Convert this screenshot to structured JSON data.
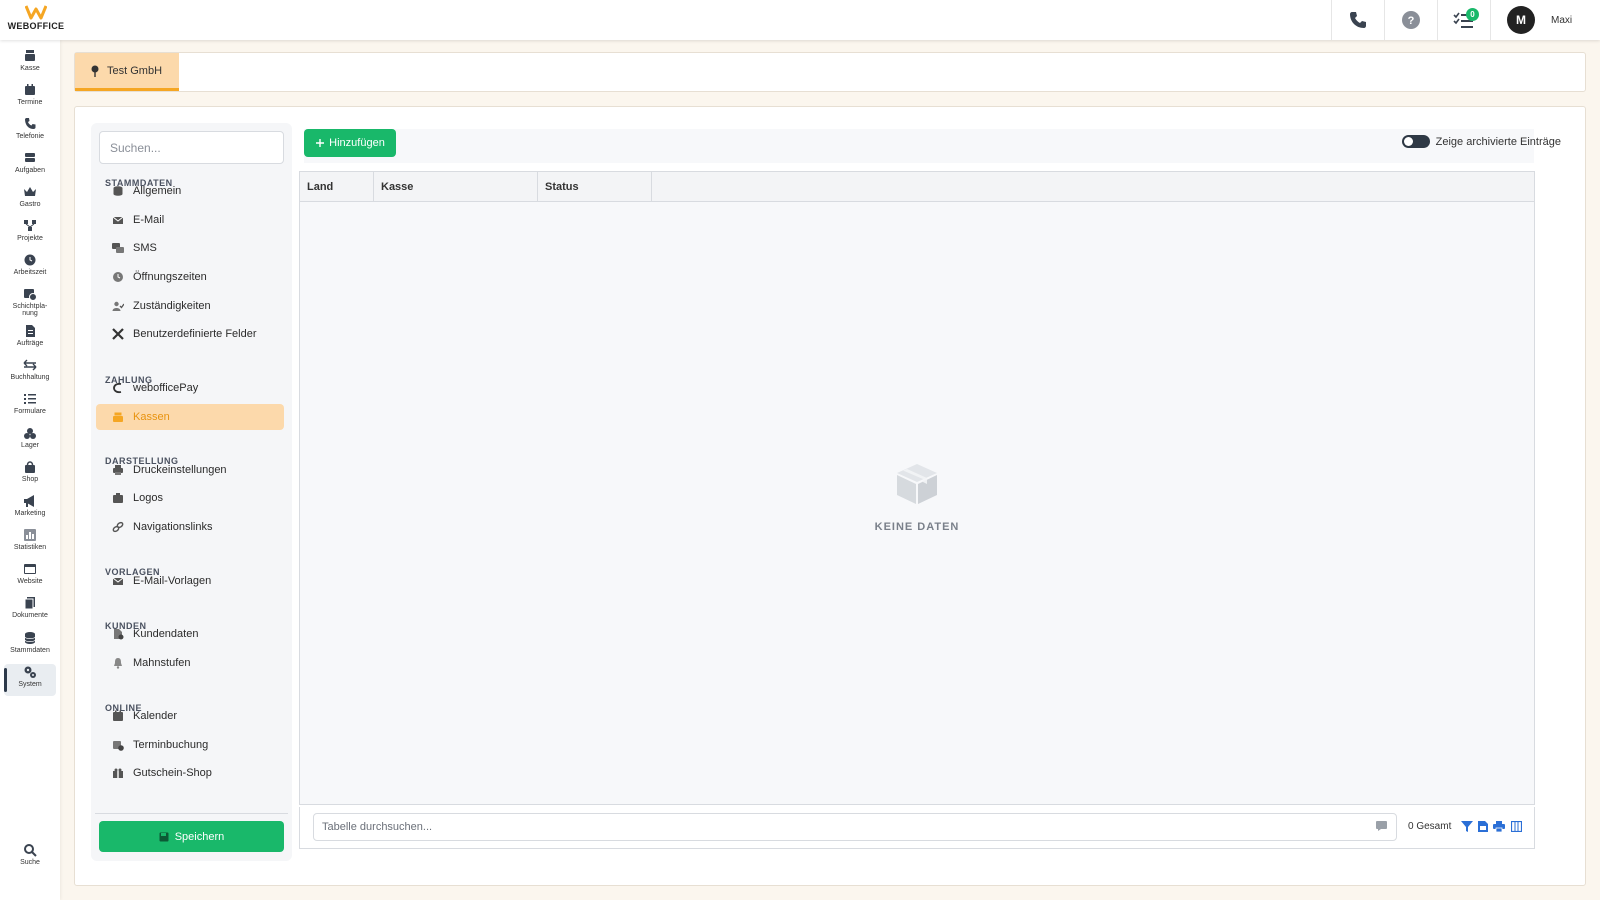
{
  "brand": {
    "name": "WEBOFFICE",
    "accent": "#f5a623",
    "green": "#19b86a"
  },
  "top": {
    "icons": [
      "phone-icon",
      "help-icon",
      "tasks-icon"
    ],
    "task_badge": "0",
    "user_initial": "M",
    "user_name": "Maxi"
  },
  "nav": [
    {
      "label": "Kasse",
      "icon": "register-icon"
    },
    {
      "label": "Termine",
      "icon": "calendar-icon"
    },
    {
      "label": "Telefonie",
      "icon": "phone-icon"
    },
    {
      "label": "Aufgaben",
      "icon": "tasks-icon"
    },
    {
      "label": "Gastro",
      "icon": "crown-icon"
    },
    {
      "label": "Projekte",
      "icon": "project-icon"
    },
    {
      "label": "Arbeitszeit",
      "icon": "clock-icon"
    },
    {
      "label": "Schichtpla-\nnung",
      "icon": "shift-icon"
    },
    {
      "label": "Aufträge",
      "icon": "order-icon"
    },
    {
      "label": "Buchhaltung",
      "icon": "exchange-icon"
    },
    {
      "label": "Formulare",
      "icon": "form-icon"
    },
    {
      "label": "Lager",
      "icon": "boxes-icon"
    },
    {
      "label": "Shop",
      "icon": "bag-icon"
    },
    {
      "label": "Marketing",
      "icon": "megaphone-icon"
    },
    {
      "label": "Statistiken",
      "icon": "chart-icon"
    },
    {
      "label": "Website",
      "icon": "browser-icon"
    },
    {
      "label": "Dokumente",
      "icon": "documents-icon"
    },
    {
      "label": "Stammdaten",
      "icon": "database-icon"
    },
    {
      "label": "System",
      "icon": "gears-icon"
    }
  ],
  "nav_search": "Suche",
  "location_tab": "Test GmbH",
  "settings": {
    "search_placeholder": "Suchen...",
    "sections": [
      {
        "title": "STAMMDATEN",
        "items": [
          "Allgemein",
          "E-Mail",
          "SMS",
          "Öffnungszeiten",
          "Zuständigkeiten",
          "Benutzerdefinierte Felder"
        ]
      },
      {
        "title": "ZAHLUNG",
        "items": [
          "webofficePay",
          "Kassen"
        ]
      },
      {
        "title": "DARSTELLUNG",
        "items": [
          "Druckeinstellungen",
          "Logos",
          "Navigationslinks"
        ]
      },
      {
        "title": "VORLAGEN",
        "items": [
          "E-Mail-Vorlagen"
        ]
      },
      {
        "title": "KUNDEN",
        "items": [
          "Kundendaten",
          "Mahnstufen"
        ]
      },
      {
        "title": "ONLINE",
        "items": [
          "Kalender",
          "Terminbuchung",
          "Gutschein-Shop"
        ]
      }
    ],
    "active_item": "Kassen",
    "save_label": "Speichern"
  },
  "table": {
    "add_label": "Hinzufügen",
    "archived_label": "Zeige archivierte Einträge",
    "archived_on": false,
    "columns": [
      "Land",
      "Kasse",
      "Status"
    ],
    "rows": [],
    "empty_text": "KEINE DATEN",
    "search_placeholder": "Tabelle durchsuchen...",
    "total": "0 Gesamt"
  }
}
